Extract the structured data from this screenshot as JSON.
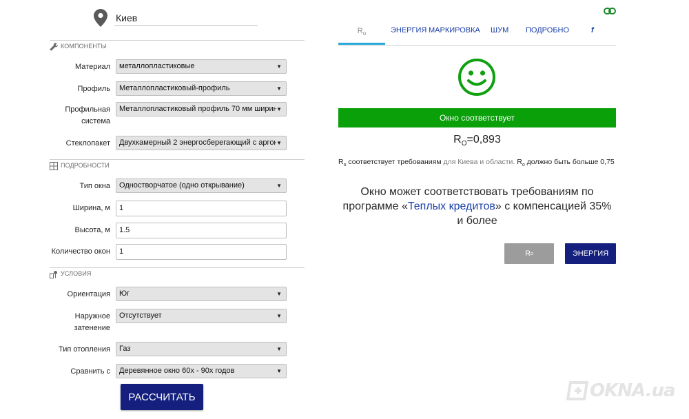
{
  "location": {
    "city": "Киев"
  },
  "sections": {
    "components": "КОМПОНЕНТЫ",
    "details": "ПОДРОБНОСТИ",
    "conditions": "УСЛОВИЯ"
  },
  "form": {
    "material": {
      "label": "Материал",
      "value": "металлопластиковые"
    },
    "profile": {
      "label": "Профиль",
      "value": "Металлопластиковый-профиль"
    },
    "profile_system": {
      "label_line1": "Профильная",
      "label_line2": "система",
      "value": "Металлопластиковый профиль 70 мм ширин"
    },
    "glass_unit": {
      "label": "Стеклопакет",
      "value": "Двухкамерный 2 энергосберегающий с аргон"
    },
    "window_type": {
      "label": "Тип окна",
      "value": "Одностворчатое (одно открывание)"
    },
    "width": {
      "label": "Ширина, м",
      "value": "1"
    },
    "height": {
      "label": "Высота, м",
      "value": "1.5"
    },
    "count": {
      "label": "Количество окон",
      "value": "1"
    },
    "orientation": {
      "label": "Ориентация",
      "value": "Юг"
    },
    "shading": {
      "label_line1": "Наружное",
      "label_line2": "затенение",
      "value": "Отсутствует"
    },
    "heating": {
      "label": "Тип отопления",
      "value": "Газ"
    },
    "compare": {
      "label": "Сравнить с",
      "value": "Деревянное окно 60х - 90х годов"
    },
    "calculate_label": "РАССЧИТАТЬ"
  },
  "tabs": {
    "ro_main": "R",
    "ro_sub": "o",
    "energy": "ЭНЕРГИЯ",
    "marking": "МАРКИРОВКА",
    "noise": "ШУМ",
    "details": "ПОДРОБНО",
    "facebook": "f"
  },
  "result": {
    "banner": "Окно соответствует",
    "ro_label_main": "R",
    "ro_label_sub": "O",
    "ro_value": "=0,893",
    "note_r": "R",
    "note_o": "o",
    "note_part1": " соответствует требованиям ",
    "note_grey": "для Киева и области.",
    "note_r2": " R",
    "note_o2": "o",
    "note_part2": " должно быть больше 0,75",
    "credit_part1": "Окно может соответствовать требованиям по программе «",
    "credit_link": "Теплых кредитов",
    "credit_part2": "» с компенсацией 35% и более",
    "btn_ro_main": "R",
    "btn_ro_sub": "o",
    "btn_energy": "ЭНЕРГИЯ"
  },
  "brand": {
    "logo": "OKNA.ua"
  },
  "colors": {
    "accent": "#141f7e",
    "success": "#0aa00a",
    "link": "#1a3fa8",
    "tab_underline": "#27a8d8"
  },
  "icons": [
    "map-pin-icon",
    "wrench-icon",
    "grid-icon",
    "conditions-icon",
    "link-icon",
    "smiley-icon"
  ]
}
